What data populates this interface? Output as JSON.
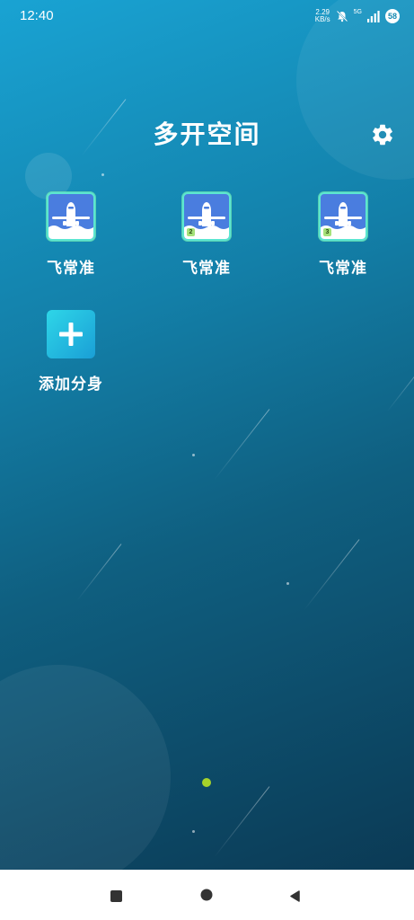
{
  "status_bar": {
    "time": "12:40",
    "net_speed_value": "2.29",
    "net_speed_unit": "KB/s",
    "network_type": "5G",
    "battery": "58",
    "icons": [
      "mute-icon",
      "signal-icon"
    ]
  },
  "header": {
    "title": "多开空间",
    "settings_icon": "gear-icon"
  },
  "apps": [
    {
      "label": "飞常准",
      "badge": ""
    },
    {
      "label": "飞常准",
      "badge": "2"
    },
    {
      "label": "飞常准",
      "badge": "3"
    }
  ],
  "add_clone": {
    "label": "添加分身",
    "icon": "plus-icon"
  },
  "page_indicator": {
    "pages": 1,
    "current": 1
  },
  "colors": {
    "accent_frame": "#5be6d1",
    "app_icon_bg": "#4a7ddf",
    "badge": "#a6e27a",
    "page_dot": "#a6d22a",
    "add_tile_start": "#2ed6e8",
    "add_tile_end": "#1a9fd6"
  },
  "nav_bar": {
    "buttons": [
      "recents-square-icon",
      "home-circle-icon",
      "back-triangle-icon"
    ]
  }
}
